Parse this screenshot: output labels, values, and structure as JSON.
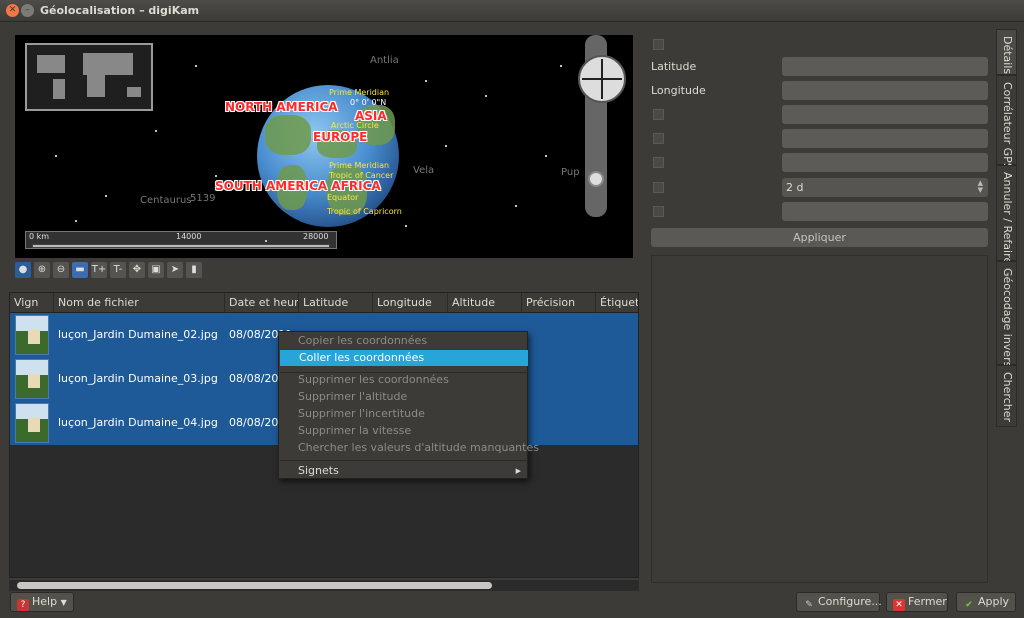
{
  "window": {
    "title": "Géolocalisation – digiKam"
  },
  "map": {
    "labels": {
      "north_america": "NORTH AMERICA",
      "asia": "ASIA",
      "europe": "EUROPE",
      "south_america_africa": "SOUTH AMERICA AFRICA"
    },
    "small_labels": {
      "meridian": "Prime Meridian",
      "coords": "0° 0' 0\"N",
      "arctic": "Arctic Circle",
      "cancer": "Tropic of Cancer",
      "equator": "Equator",
      "capricorn": "Tropic of Capricorn"
    },
    "star_labels": {
      "antlia": "Antlia",
      "vela": "Vela",
      "centaurus": "Centaurus",
      "pup": "Pup",
      "num": "5139"
    },
    "scale": {
      "start": "0 km",
      "mid": "14000",
      "end": "28000"
    }
  },
  "map_toolbar": {
    "icons": [
      "globe-icon",
      "zoom-in-icon",
      "zoom-out-icon",
      "flag-icon",
      "text-plus-icon",
      "text-minus-icon",
      "move-icon",
      "select-icon",
      "pointer-icon",
      "cylinder-icon"
    ],
    "text_plus": "T+",
    "text_minus": "T-"
  },
  "table": {
    "columns": [
      "Vign",
      "Nom de fichier",
      "Date et heure",
      "Latitude",
      "Longitude",
      "Altitude",
      "Précision",
      "Étiquet"
    ],
    "rows": [
      {
        "filename": "luçon_Jardin Dumaine_02.jpg",
        "date": "08/08/2011"
      },
      {
        "filename": "luçon_Jardin Dumaine_03.jpg",
        "date": "08/08/2011"
      },
      {
        "filename": "luçon_Jardin Dumaine_04.jpg",
        "date": "08/08/2011"
      }
    ]
  },
  "context_menu": {
    "copy": "Copier les coordonnées",
    "paste": "Coller les coordonnées",
    "delete_coords": "Supprimer les coordonnées",
    "delete_altitude": "Supprimer l'altitude",
    "delete_uncertainty": "Supprimer l'incertitude",
    "delete_speed": "Supprimer la vitesse",
    "lookup_altitude": "Chercher les valeurs d'altitude manquantes",
    "bookmarks": "Signets"
  },
  "details": {
    "latitude_label": "Latitude",
    "longitude_label": "Longitude",
    "combo_value": "2 d",
    "apply_label": "Appliquer"
  },
  "side_tabs": [
    "Détails",
    "Corrélateur GPS",
    "Annuler / Refaire",
    "Géocodage inversé",
    "Chercher"
  ],
  "footer": {
    "help_label": "Help",
    "configure_label": "Configure...",
    "close_label": "Fermer",
    "apply_label": "Apply"
  },
  "colors": {
    "selection": "#1e5a98",
    "menu_highlight": "#27a5d8",
    "window_bg": "#3c3b37"
  }
}
